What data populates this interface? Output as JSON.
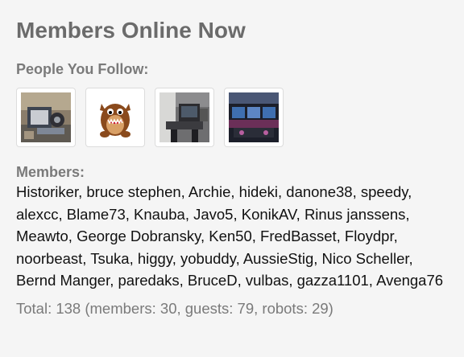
{
  "widget": {
    "title": "Members Online Now",
    "following_label": "People You Follow:",
    "members_label": "Members:",
    "members": [
      "Historiker",
      "bruce stephen",
      "Archie",
      "hideki",
      "danone38",
      "speedy",
      "alexcc",
      "Blame73",
      "Knauba",
      "Javo5",
      "KonikAV",
      "Rinus janssens",
      "Meawto",
      "George Dobransky",
      "Ken50",
      "FredBasset",
      "Floydpr",
      "noorbeast",
      "Tsuka",
      "higgy",
      "yobuddy",
      "AussieStig",
      "Nico Scheller",
      "Bernd Manger",
      "paredaks",
      "BruceD",
      "vulbas",
      "gazza1101",
      "Avenga76"
    ],
    "total_text": "Total: 138 (members: 30, guests: 79, robots: 29)"
  },
  "followed_avatars": [
    {
      "icon": "photo-avatar-workbench"
    },
    {
      "icon": "tasmanian-devil-avatar"
    },
    {
      "icon": "photo-avatar-workshop"
    },
    {
      "icon": "photo-avatar-cockpit"
    }
  ],
  "colors": {
    "background": "#f5f5f5",
    "heading": "#6b6b6b",
    "label": "#7a7a7a",
    "text": "#111111"
  }
}
